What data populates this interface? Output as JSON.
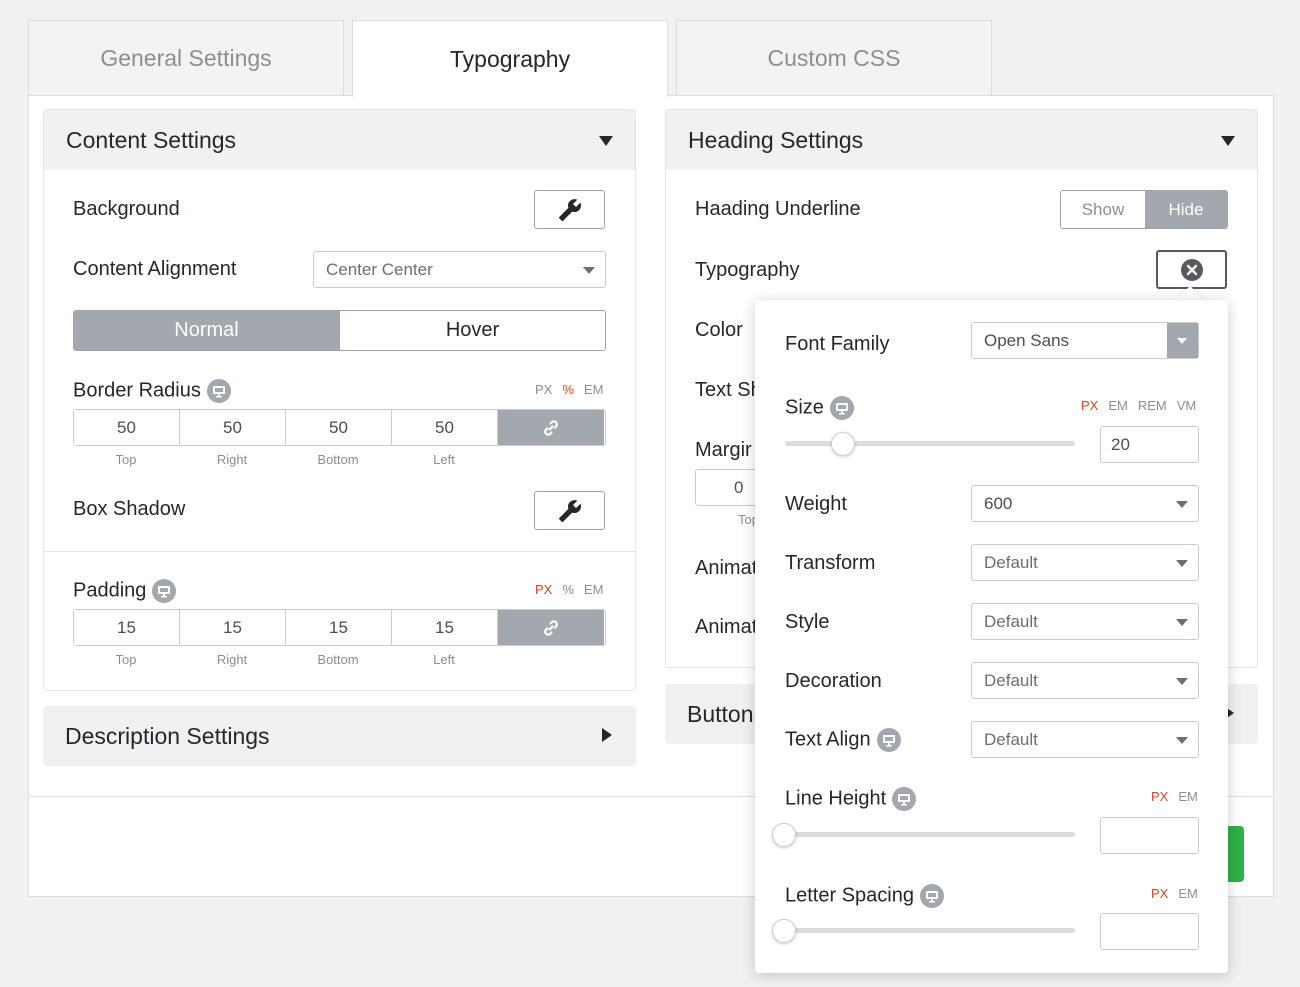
{
  "tabs": [
    {
      "label": "General Settings"
    },
    {
      "label": "Typography"
    },
    {
      "label": "Custom CSS"
    }
  ],
  "content_settings": {
    "title": "Content Settings",
    "background_label": "Background",
    "alignment_label": "Content Alignment",
    "alignment_value": "Center Center",
    "state_normal": "Normal",
    "state_hover": "Hover",
    "border_radius_label": "Border Radius",
    "border_radius_units": [
      "PX",
      "%",
      "EM"
    ],
    "border_radius_values": [
      "50",
      "50",
      "50",
      "50"
    ],
    "side_labels": [
      "Top",
      "Right",
      "Bottom",
      "Left"
    ],
    "box_shadow_label": "Box Shadow",
    "padding_label": "Padding",
    "padding_units": [
      "PX",
      "%",
      "EM"
    ],
    "padding_values": [
      "15",
      "15",
      "15",
      "15"
    ]
  },
  "description_settings": {
    "title": "Description Settings"
  },
  "heading_settings": {
    "title": "Heading Settings",
    "underline_label": "Haading Underline",
    "underline_show": "Show",
    "underline_hide": "Hide",
    "typography_label": "Typography",
    "color_label": "Color",
    "text_shadow_label": "Text Sh",
    "margin_label": "Margir",
    "margin_value": "0",
    "margin_side": "Top",
    "animation1_label": "Animat",
    "animation2_label": "Animat"
  },
  "button_settings": {
    "title": "Button"
  },
  "typography_popup": {
    "font_family_label": "Font Family",
    "font_family_value": "Open Sans",
    "size_label": "Size",
    "size_units": [
      "PX",
      "EM",
      "REM",
      "VM"
    ],
    "size_value": "20",
    "weight_label": "Weight",
    "weight_value": "600",
    "transform_label": "Transform",
    "transform_value": "Default",
    "style_label": "Style",
    "style_value": "Default",
    "decoration_label": "Decoration",
    "decoration_value": "Default",
    "text_align_label": "Text Align",
    "text_align_value": "Default",
    "line_height_label": "Line Height",
    "line_height_units": [
      "PX",
      "EM"
    ],
    "line_height_value": "",
    "letter_spacing_label": "Letter Spacing",
    "letter_spacing_units": [
      "PX",
      "EM"
    ],
    "letter_spacing_value": ""
  },
  "colors": {
    "accent_unit": "#e2401c",
    "toggle_active": "#a2a8ad",
    "save_button": "#30b04a"
  }
}
